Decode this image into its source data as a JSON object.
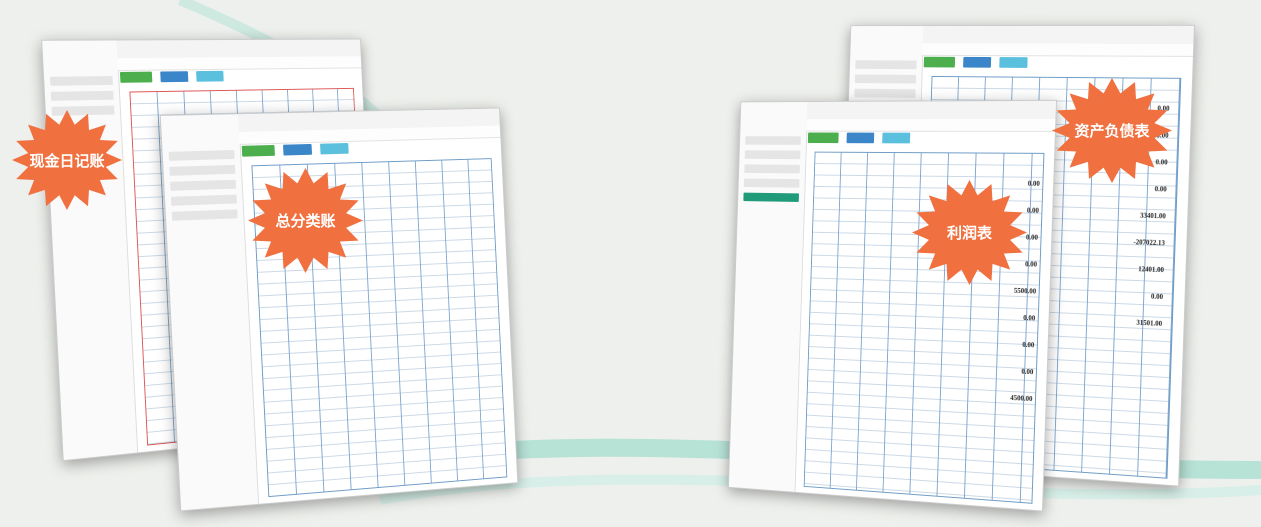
{
  "labels": {
    "cash_journal": "现金日记账",
    "general_ledger": "总分类账",
    "income_statement": "利润表",
    "balance_sheet": "资产负债表"
  },
  "colors": {
    "starburst": "#f0703f",
    "accent_green": "#1f9b7a",
    "ledger_blue": "#6e9cc6",
    "ribbon_red": "#e63b2e"
  },
  "balance_values": [
    "0.00",
    "0.00",
    "0.00",
    "0.00",
    "33401.00",
    "-207022.13",
    "12401.00",
    "0.00",
    "31501.00"
  ],
  "income_values": [
    "0.00",
    "0.00",
    "0.00",
    "0.00",
    "5500.00",
    "0.00",
    "0.00",
    "0.00",
    "4500.00"
  ]
}
